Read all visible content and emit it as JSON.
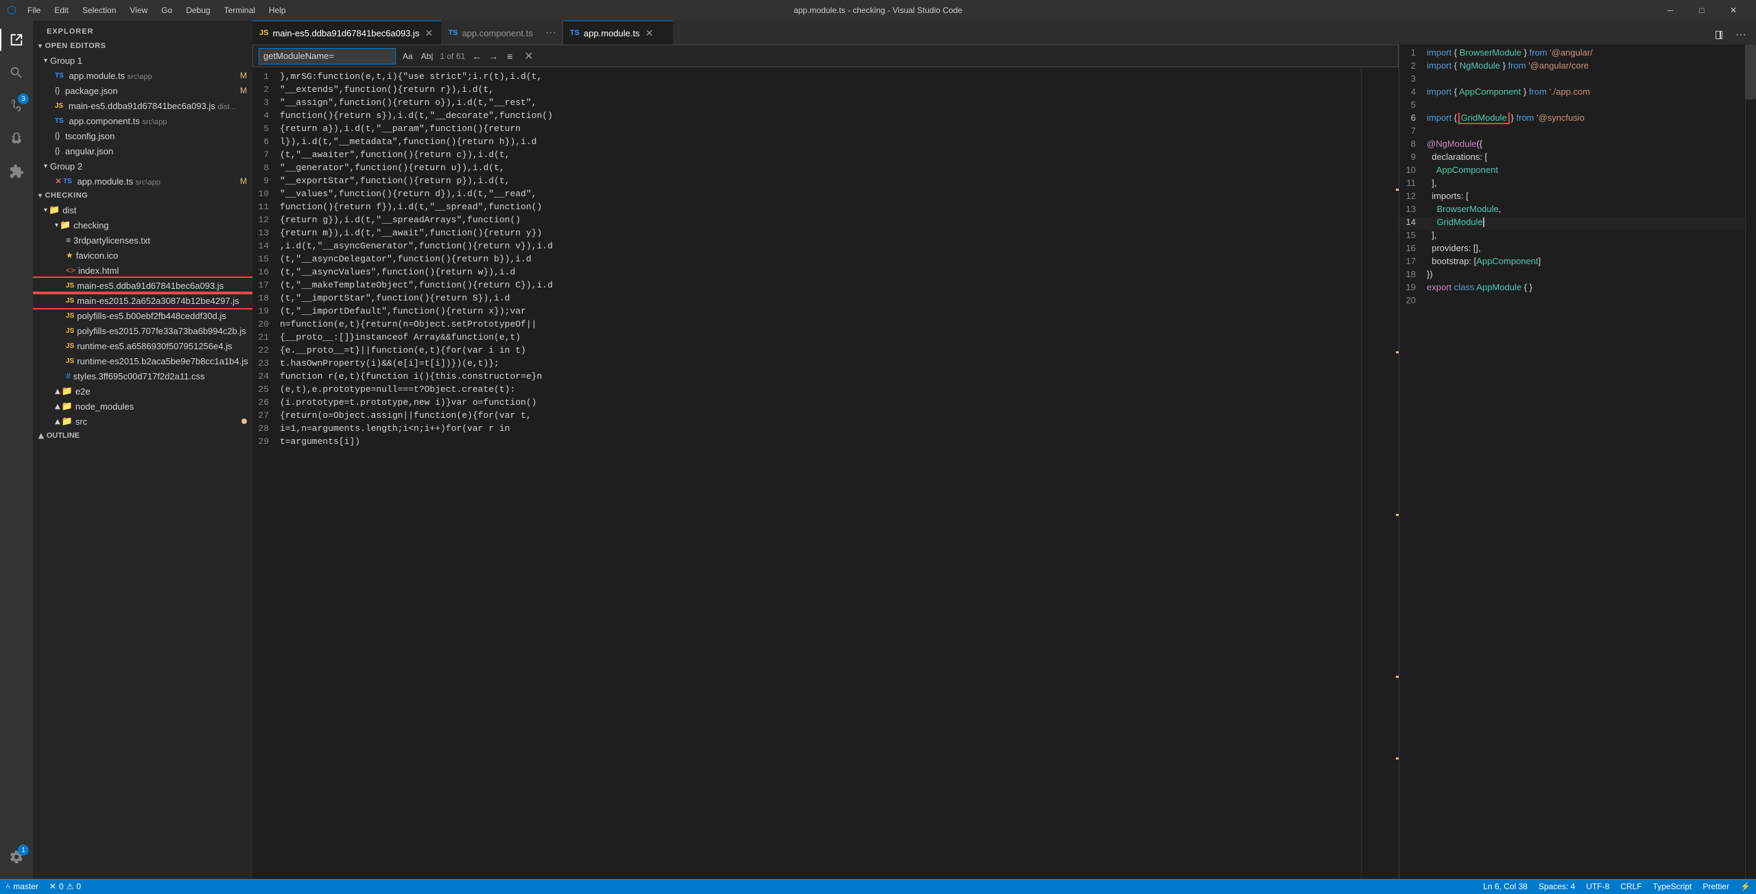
{
  "titleBar": {
    "title": "app.module.ts - checking - Visual Studio Code",
    "logo": "⬡",
    "menus": [
      "File",
      "Edit",
      "Selection",
      "View",
      "Go",
      "Debug",
      "Terminal",
      "Help"
    ],
    "controls": {
      "minimize": "─",
      "maximize": "□",
      "close": "✕"
    }
  },
  "activityBar": {
    "items": [
      {
        "name": "explorer",
        "icon": "📄",
        "active": true
      },
      {
        "name": "search",
        "icon": "🔍",
        "active": false
      },
      {
        "name": "source-control",
        "icon": "⑃",
        "active": false,
        "badge": "3"
      },
      {
        "name": "debug",
        "icon": "▷",
        "active": false
      },
      {
        "name": "extensions",
        "icon": "⊞",
        "active": false
      }
    ],
    "bottom": {
      "icon": "⚙",
      "badge": "1"
    }
  },
  "sidebar": {
    "header": "Explorer",
    "sections": {
      "openEditors": {
        "label": "Open Editors",
        "groups": {
          "group1": {
            "label": "Group 1",
            "items": [
              {
                "icon": "TS",
                "iconType": "ts",
                "name": "app.module.ts",
                "path": "src\\app",
                "modified": "M"
              },
              {
                "icon": "{}",
                "iconType": "json",
                "name": "package.json",
                "path": "",
                "modified": "M"
              },
              {
                "icon": "JS",
                "iconType": "js",
                "name": "main-es5.ddba91d67841bec6a093.js",
                "path": "dist...",
                "modified": ""
              },
              {
                "icon": "TS",
                "iconType": "ts",
                "name": "app.component.ts",
                "path": "src\\app",
                "modified": ""
              },
              {
                "icon": "{}",
                "iconType": "json",
                "name": "tsconfig.json",
                "path": "",
                "modified": ""
              },
              {
                "icon": "{}",
                "iconType": "json",
                "name": "angular.json",
                "path": "",
                "modified": ""
              }
            ]
          },
          "group2": {
            "label": "Group 2",
            "items": [
              {
                "icon": "TS",
                "iconType": "ts",
                "name": "app.module.ts",
                "path": "src\\app",
                "modified": "M",
                "prefix": "✕"
              }
            ]
          }
        }
      },
      "checking": {
        "label": "CHECKING",
        "tree": [
          {
            "indent": 1,
            "type": "folder",
            "name": "dist",
            "open": true
          },
          {
            "indent": 2,
            "type": "folder",
            "name": "checking",
            "open": true
          },
          {
            "indent": 3,
            "type": "file",
            "icon": "≡",
            "iconColor": "#cccccc",
            "name": "3rdpartylicenses.txt"
          },
          {
            "indent": 3,
            "type": "file",
            "icon": "★",
            "iconColor": "#f0c040",
            "name": "favicon.ico"
          },
          {
            "indent": 3,
            "type": "file",
            "icon": "<>",
            "iconColor": "#e07b53",
            "name": "index.html"
          },
          {
            "indent": 3,
            "type": "file",
            "icon": "JS",
            "iconColor": "#f0c040",
            "name": "main-es5.ddba91d67841bec6a093.js",
            "highlighted": true
          },
          {
            "indent": 3,
            "type": "file",
            "icon": "JS",
            "iconColor": "#f0c040",
            "name": "main-es2015.2a652a30874b12be4297.js",
            "highlighted": true
          },
          {
            "indent": 3,
            "type": "file",
            "icon": "JS",
            "iconColor": "#f0c040",
            "name": "polyfills-es5.b00ebf2fb448ceddf30d.js"
          },
          {
            "indent": 3,
            "type": "file",
            "icon": "JS",
            "iconColor": "#f0c040",
            "name": "polyfills-es2015.707fe33a73ba6b994c2b.js"
          },
          {
            "indent": 3,
            "type": "file",
            "icon": "JS",
            "iconColor": "#f0c040",
            "name": "runtime-es5.a6586930f507951256e4.js"
          },
          {
            "indent": 3,
            "type": "file",
            "icon": "JS",
            "iconColor": "#f0c040",
            "name": "runtime-es2015.b2aca5be9e7b8cc1a1b4.js"
          },
          {
            "indent": 3,
            "type": "file",
            "icon": "#",
            "iconColor": "#519aba",
            "name": "styles.3ff695c00d717f2d2a11.css"
          },
          {
            "indent": 2,
            "type": "folder",
            "name": "e2e",
            "open": false
          },
          {
            "indent": 2,
            "type": "folder",
            "name": "node_modules",
            "open": false
          },
          {
            "indent": 2,
            "type": "folder",
            "name": "src",
            "open": false
          }
        ]
      },
      "outline": {
        "label": "OUTLINE"
      }
    }
  },
  "tabs": {
    "left": [
      {
        "icon": "JS",
        "iconType": "js",
        "name": "main-es5.ddba91d67841bec6a093.js",
        "active": true,
        "closable": true
      },
      {
        "icon": "TS",
        "iconType": "ts",
        "name": "app.component.ts",
        "active": false,
        "closable": false
      }
    ],
    "right": [
      {
        "icon": "TS",
        "iconType": "ts",
        "name": "app.module.ts",
        "active": true,
        "closable": true
      }
    ]
  },
  "findWidget": {
    "placeholder": "getModuleName=",
    "value": "getModuleName=",
    "matchCase": "Aa",
    "wholeWord": "Ab|",
    "count": "1 of 61",
    "prev": "←",
    "next": "→",
    "more": "≡",
    "close": "✕"
  },
  "leftEditor": {
    "language": "JavaScript",
    "lines": [
      "},mrSG:function(e,t,i){\"use strict\";i.r(t),i.d(t,",
      "\"__extends\",function(){return r}),i.d(t,",
      "\"__assign\",function(){return o}),i.d(t,\"__rest\",",
      "function(){return s}),i.d(t,\"__decorate\",function()",
      "{return a}),i.d(t,\"__param\",function(){return",
      "l}),i.d(t,\"__metadata\",function(){return h}),i.d",
      "(t,\"__awaiter\",function(){return c}),i.d(t,",
      "\"__generator\",function(){return u}),i.d(t,",
      "\"__exportStar\",function(){return p}),i.d(t,",
      "\"__values\",function(){return d}),i.d(t,\"__read\",",
      "function(){return f}),i.d(t,\"__spread\",function()",
      "{return g}),i.d(t,\"__spreadArrays\",function()",
      "{return m}),i.d(t,\"__await\",function(){return y})",
      ",i.d(t,\"__asyncGenerator\",function(){return v}),i.d",
      "(t,\"__asyncDelegator\",function(){return b}),i.d",
      "(t,\"__asyncValues\",function(){return w}),i.d",
      "(t,\"__makeTemplateObject\",function(){return C}),i.d",
      "(t,\"__importStar\",function(){return S}),i.d",
      "(t,\"__importDefault\",function(){return x});var",
      "n=function(e,t){return(n=Object.setPrototypeOf||",
      "{__proto__:[]}instanceof Array&&function(e,t)",
      "{e.__proto__=t}||function(e,t){for(var i in t)",
      "t.hasOwnProperty(i)&&(e[i]=t[i])})(e,t)};",
      "function r(e,t){function i(){this.constructor=e}n",
      "(e,t),e.prototype=null===t?Object.create(t):",
      "(i.prototype=t.prototype,new i)}var o=function()",
      "{return(o=Object.assign||function(e){for(var t,",
      "i=1,n=arguments.length;i<n;i++)for(var r in",
      "t=arguments[i])"
    ]
  },
  "rightEditor": {
    "filename": "app.module.ts",
    "lines": [
      {
        "num": 1,
        "content": "import { BrowserModule } from '@angular/"
      },
      {
        "num": 2,
        "content": "import { NgModule } from '@angular/core"
      },
      {
        "num": 3,
        "content": ""
      },
      {
        "num": 4,
        "content": "import { AppComponent } from './app.com"
      },
      {
        "num": 5,
        "content": ""
      },
      {
        "num": 6,
        "content": "import { GridModule } from '@syncfusio"
      },
      {
        "num": 7,
        "content": ""
      },
      {
        "num": 8,
        "content": "@NgModule({"
      },
      {
        "num": 9,
        "content": "  declarations: ["
      },
      {
        "num": 10,
        "content": "    AppComponent"
      },
      {
        "num": 11,
        "content": "  ],"
      },
      {
        "num": 12,
        "content": "  imports: ["
      },
      {
        "num": 13,
        "content": "    BrowserModule,"
      },
      {
        "num": 14,
        "content": "    GridModule"
      },
      {
        "num": 15,
        "content": "  ],"
      },
      {
        "num": 16,
        "content": "  providers: [],"
      },
      {
        "num": 17,
        "content": "  bootstrap: [AppComponent]"
      },
      {
        "num": 18,
        "content": "})"
      },
      {
        "num": 19,
        "content": "export class AppModule { }"
      },
      {
        "num": 20,
        "content": ""
      }
    ]
  },
  "statusBar": {
    "left": [
      {
        "icon": "⑃",
        "text": "master"
      },
      {
        "icon": "⚠",
        "text": "0"
      },
      {
        "icon": "✕",
        "text": "0"
      }
    ],
    "right": [
      {
        "text": "Ln 6, Col 38"
      },
      {
        "text": "Spaces: 4"
      },
      {
        "text": "UTF-8"
      },
      {
        "text": "CRLF"
      },
      {
        "text": "TypeScript"
      },
      {
        "text": "Prettier"
      },
      {
        "text": "⚡"
      }
    ]
  }
}
